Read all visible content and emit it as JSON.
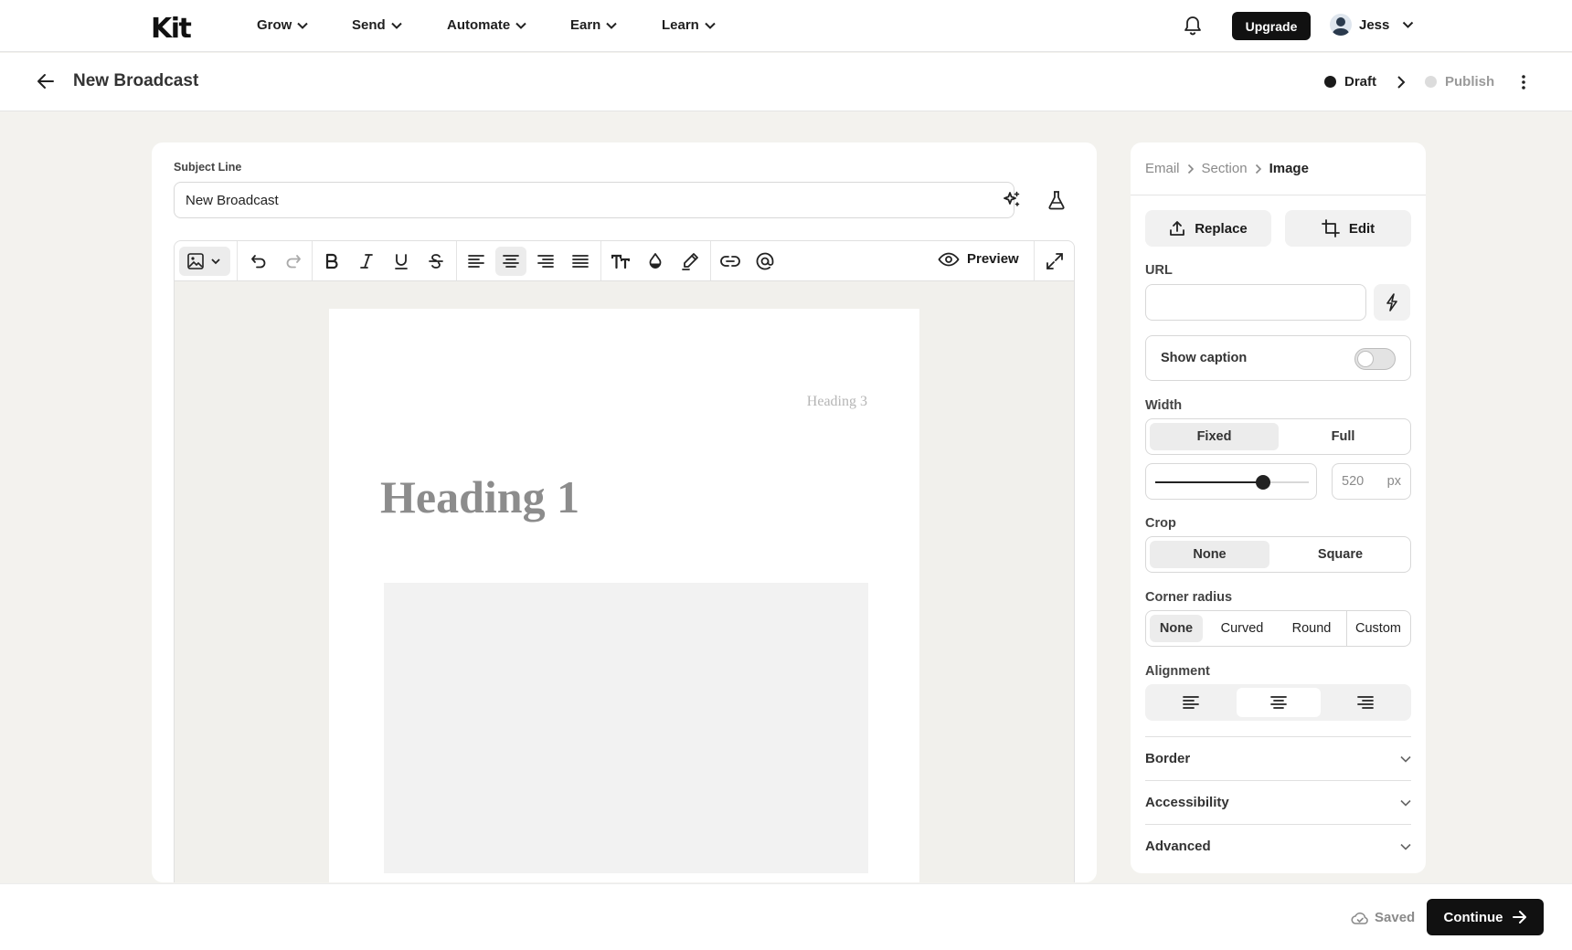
{
  "nav": {
    "logo": "Kit",
    "items": [
      {
        "label": "Grow"
      },
      {
        "label": "Send"
      },
      {
        "label": "Automate"
      },
      {
        "label": "Earn"
      },
      {
        "label": "Learn"
      }
    ],
    "upgrade_label": "Upgrade",
    "user_name": "Jess",
    "icons": {
      "bell": "bell-icon",
      "user": "user-avatar-icon",
      "chevron": "chevron-down-icon"
    }
  },
  "header": {
    "title": "New Broadcast",
    "status": {
      "current": "Draft",
      "next": "Publish"
    },
    "colors": {
      "draft_dot": "#1a1a1a",
      "publish_dot": "#dcdcdc"
    }
  },
  "editor": {
    "subject_label": "Subject Line",
    "subject_value": "New Broadcast",
    "toolbar": {
      "preview_label": "Preview",
      "active_tool": "align-center"
    },
    "content": {
      "heading3": "Heading 3",
      "heading1": "Heading 1"
    }
  },
  "panel": {
    "breadcrumb": [
      "Email",
      "Section",
      "Image"
    ],
    "replace_label": "Replace",
    "edit_label": "Edit",
    "url_label": "URL",
    "url_value": "",
    "show_caption_label": "Show caption",
    "show_caption_on": false,
    "width": {
      "label": "Width",
      "options": [
        "Fixed",
        "Full"
      ],
      "selected": "Fixed",
      "value": "520",
      "unit": "px",
      "slider_fraction": 0.7
    },
    "crop": {
      "label": "Crop",
      "options": [
        "None",
        "Square"
      ],
      "selected": "None"
    },
    "corner_radius": {
      "label": "Corner radius",
      "options": [
        "None",
        "Curved",
        "Round",
        "Custom"
      ],
      "selected": "None"
    },
    "alignment": {
      "label": "Alignment",
      "selected": "center"
    },
    "sections": [
      "Border",
      "Accessibility",
      "Advanced"
    ]
  },
  "footer": {
    "saved_label": "Saved",
    "continue_label": "Continue"
  }
}
